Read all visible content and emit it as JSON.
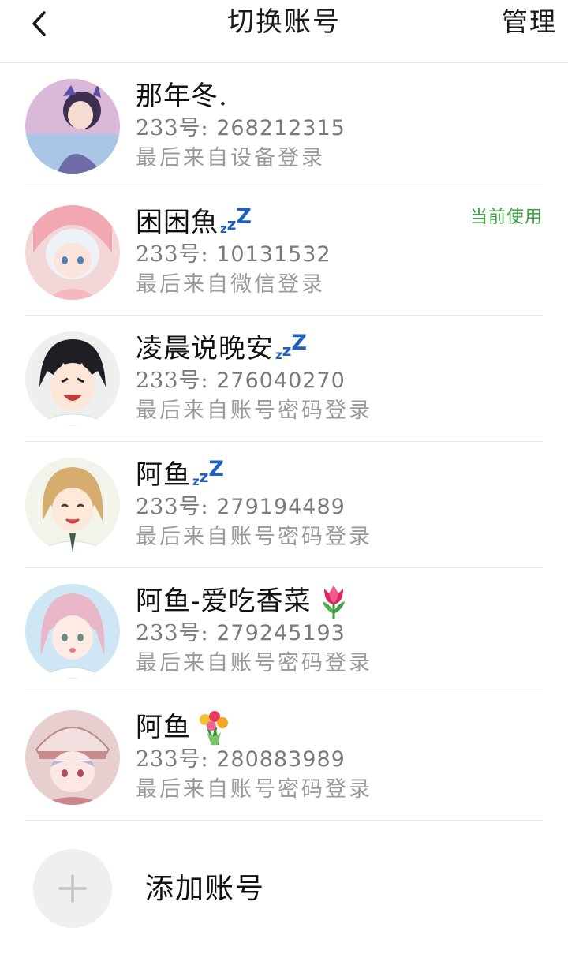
{
  "header": {
    "back_icon": "chevron-left-icon",
    "title": "切换账号",
    "manage_label": "管理"
  },
  "accounts": [
    {
      "name": "那年冬.",
      "id_prefix": "233号:",
      "id_value": "268212315",
      "source": "最后来自设备登录",
      "badge": "",
      "status_icon": "",
      "emoji": ""
    },
    {
      "name": "困困魚",
      "id_prefix": "233号:",
      "id_value": "10131532",
      "source": "最后来自微信登录",
      "badge": "当前使用",
      "status_icon": "zzz-icon",
      "emoji": ""
    },
    {
      "name": "凌晨说晚安",
      "id_prefix": "233号:",
      "id_value": "276040270",
      "source": "最后来自账号密码登录",
      "badge": "",
      "status_icon": "zzz-icon",
      "emoji": ""
    },
    {
      "name": "阿鱼",
      "id_prefix": "233号:",
      "id_value": "279194489",
      "source": "最后来自账号密码登录",
      "badge": "",
      "status_icon": "zzz-icon",
      "emoji": ""
    },
    {
      "name": "阿鱼-爱吃香菜",
      "id_prefix": "233号:",
      "id_value": "279245193",
      "source": "最后来自账号密码登录",
      "badge": "",
      "status_icon": "",
      "emoji": "tulip-icon"
    },
    {
      "name": "阿鱼",
      "id_prefix": "233号:",
      "id_value": "280883989",
      "source": "最后来自账号密码登录",
      "badge": "",
      "status_icon": "",
      "emoji": "bouquet-icon"
    }
  ],
  "add_account": {
    "icon": "plus-icon",
    "label": "添加账号"
  },
  "colors": {
    "current_badge": "#3ea342",
    "zzz": "#1f5fc4",
    "secondary_text": "#7a7a7a",
    "tertiary_text": "#9a9a9a",
    "divider": "#e9e9e9"
  }
}
